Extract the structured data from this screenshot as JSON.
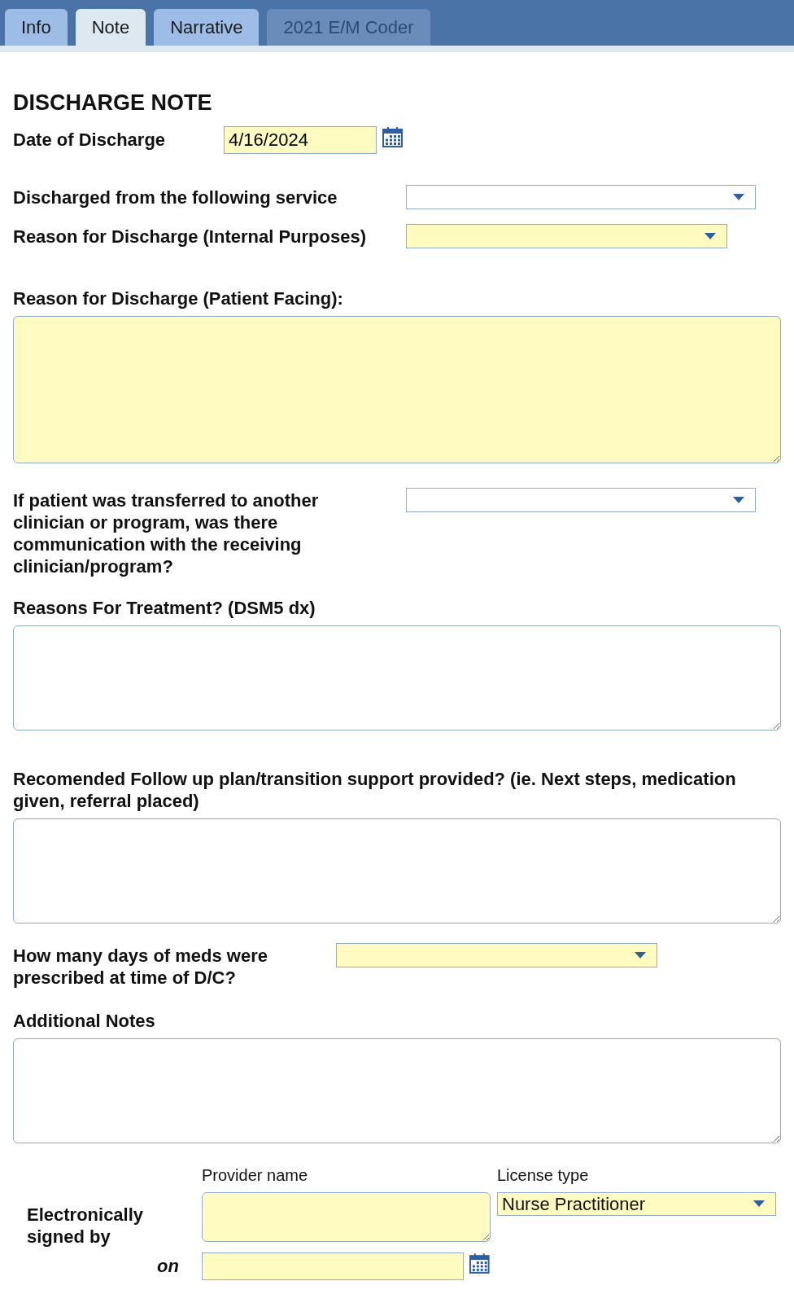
{
  "tabs": [
    {
      "label": "Info",
      "selected": false,
      "disabled": false
    },
    {
      "label": "Note",
      "selected": true,
      "disabled": false
    },
    {
      "label": "Narrative",
      "selected": false,
      "disabled": false
    },
    {
      "label": "2021 E/M Coder",
      "selected": false,
      "disabled": true
    }
  ],
  "title": "DISCHARGE NOTE",
  "fields": [
    {
      "kind": "date",
      "label": "Date of Discharge",
      "value": "4/16/2024",
      "required": true
    },
    {
      "kind": "select",
      "label": "Discharged from the following service",
      "required": false
    },
    {
      "kind": "select",
      "label": "Reason for Discharge (Internal Purposes)",
      "required": true
    },
    {
      "kind": "textarea",
      "label": "Reason for Discharge (Patient Facing):",
      "required": true
    },
    {
      "kind": "select",
      "label": "If patient was transferred to another clinician or program, was there communication with the receiving clinician/program?",
      "required": false
    },
    {
      "kind": "textarea",
      "label": "Reasons For Treatment? (DSM5 dx)",
      "required": false
    },
    {
      "kind": "textarea",
      "label": "Recomended Follow up plan/transition support provided? (ie. Next steps, medication given, referral placed)",
      "required": false
    },
    {
      "kind": "select",
      "label": "How many days of meds were prescribed at time of D/C?",
      "required": true
    },
    {
      "kind": "textarea",
      "label": "Additional Notes",
      "required": false
    }
  ],
  "signature": {
    "label": "Electronically signed by",
    "provider_label": "Provider name",
    "license_label": "License type",
    "license_value": "Nurse Practitioner",
    "on_label": "on"
  }
}
